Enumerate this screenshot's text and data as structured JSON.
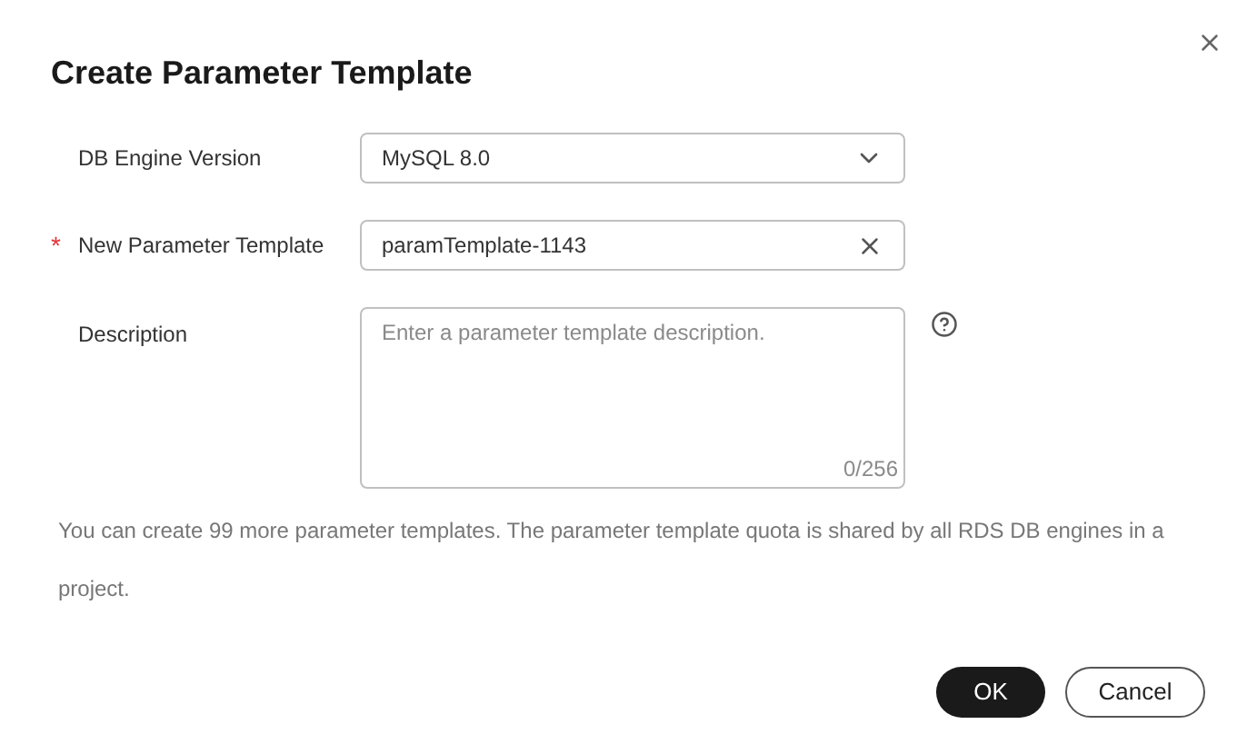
{
  "dialog": {
    "title": "Create Parameter Template"
  },
  "fields": [
    {
      "kind": "select",
      "label": "DB Engine Version",
      "value": "MySQL 8.0"
    },
    {
      "kind": "text",
      "label": "New Parameter Template",
      "required_mark": "*",
      "value": "paramTemplate-1143"
    },
    {
      "kind": "textarea",
      "label": "Description",
      "placeholder": "Enter a parameter template description.",
      "counter": "0/256"
    }
  ],
  "note": "You can create 99 more parameter templates. The parameter template quota is shared by all RDS DB engines in a project.",
  "buttons": [
    {
      "label": "OK",
      "kind": "primary"
    },
    {
      "label": "Cancel",
      "kind": "secondary"
    }
  ]
}
